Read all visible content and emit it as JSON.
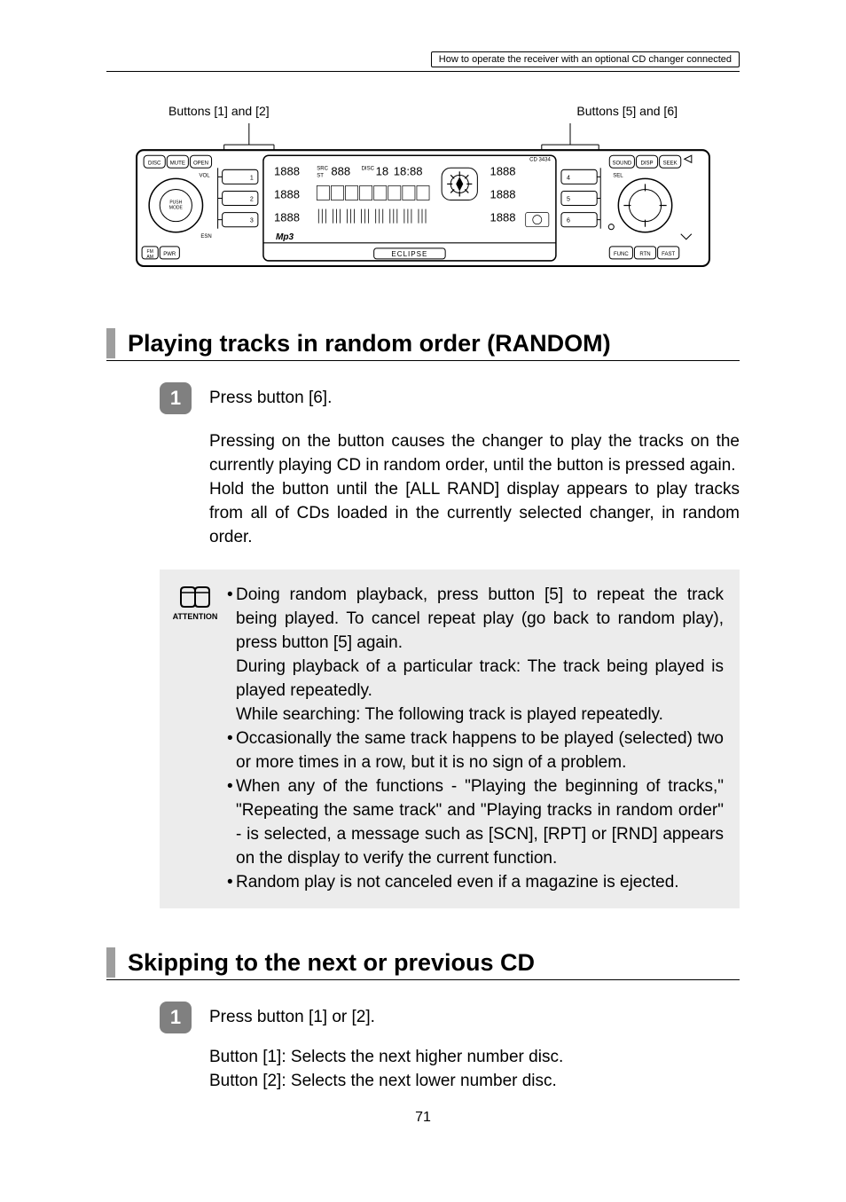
{
  "header": {
    "breadcrumb": "How to operate the receiver with an optional CD changer connected"
  },
  "diagram": {
    "callout_left": "Buttons [1] and [2]",
    "callout_right": "Buttons [5] and [6]",
    "left_buttons": {
      "disc": "DISC",
      "mute": "MUTE",
      "open": "OPEN",
      "vol": "VOL",
      "push_mode": "PUSH MODE",
      "esn": "ESN",
      "fm": "FM",
      "am": "AM",
      "pwr": "PWR"
    },
    "number_col_left": [
      "1",
      "2",
      "3"
    ],
    "number_col_right": [
      "4",
      "5",
      "6"
    ],
    "right_buttons": {
      "sound": "SOUND",
      "disp": "DISP",
      "seek": "SEEK",
      "sel": "SEL",
      "func": "FUNC",
      "rtn": "RTN",
      "fast": "FAST"
    },
    "center_labels": {
      "src": "SRC",
      "st": "ST",
      "disc": "DISC",
      "mp3": "MP3",
      "eclipse": "ECLIPSE",
      "cd": "CD 3434"
    }
  },
  "section1": {
    "title": "Playing tracks in random order (RANDOM)",
    "step_num": "1",
    "step_text": "Press button [6].",
    "para1": "Pressing on the button causes the changer to play the tracks on the currently playing CD in random order, until the button is pressed again.",
    "para2": "Hold the button until the [ALL RAND] display appears to play tracks from all of CDs loaded in the currently selected changer, in random order.",
    "attention_label": "ATTENTION",
    "bullets": [
      "Doing random playback, press button [5] to repeat the track being played. To cancel repeat play (go back to random play), press button [5] again.",
      "During playback of a particular track: The track being played is played repeatedly.",
      "While searching: The following track is played repeatedly.",
      "Occasionally the same track happens to be played (selected) two or more times in a row, but it is no sign of a problem.",
      "When any of the functions - \"Playing the beginning of tracks,\" \"Repeating the same track\" and \"Playing tracks in random order\" - is selected, a message such as [SCN], [RPT] or [RND] appears on the display to verify the current function.",
      "Random play is not canceled even if a magazine is ejected."
    ]
  },
  "section2": {
    "title": "Skipping to the next or previous CD",
    "step_num": "1",
    "step_text": "Press button [1] or [2].",
    "line1": "Button [1]:  Selects the next higher number disc.",
    "line2": "Button [2]:  Selects the next lower number disc."
  },
  "page_number": "71"
}
